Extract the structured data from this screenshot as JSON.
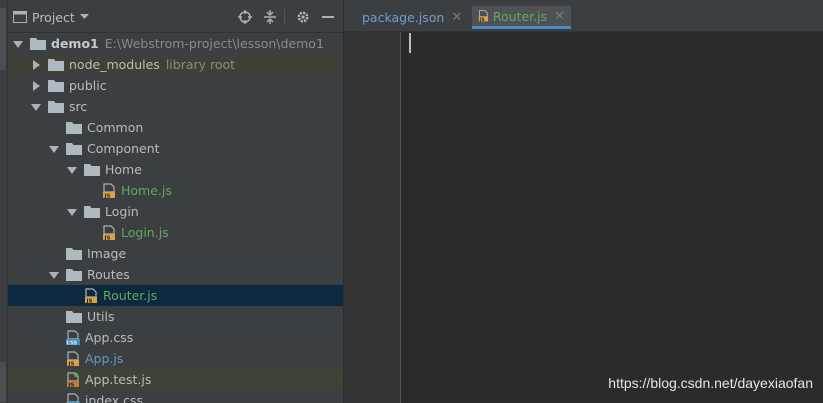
{
  "project_panel": {
    "title": "Project",
    "header_icons": [
      "locate-icon",
      "collapse-icon",
      "gear-icon",
      "minimize-icon"
    ]
  },
  "tree": [
    {
      "indent": 0,
      "expanded": true,
      "type": "folder",
      "label": "demo1",
      "hint": "E:\\Webstrom-project\\lesson\\demo1",
      "bold": true
    },
    {
      "indent": 1,
      "expanded": false,
      "type": "folder",
      "label": "node_modules",
      "hint": "library root",
      "bg": "brown"
    },
    {
      "indent": 1,
      "expanded": false,
      "type": "folder",
      "label": "public"
    },
    {
      "indent": 1,
      "expanded": true,
      "type": "folder",
      "label": "src"
    },
    {
      "indent": 2,
      "type": "folder",
      "label": "Common"
    },
    {
      "indent": 2,
      "expanded": true,
      "type": "folder",
      "label": "Component"
    },
    {
      "indent": 3,
      "expanded": true,
      "type": "folder",
      "label": "Home"
    },
    {
      "indent": 4,
      "type": "js",
      "label": "Home.js",
      "color": "green"
    },
    {
      "indent": 3,
      "expanded": true,
      "type": "folder",
      "label": "Login"
    },
    {
      "indent": 4,
      "type": "js",
      "label": "Login.js",
      "color": "green"
    },
    {
      "indent": 2,
      "type": "folder",
      "label": "Image"
    },
    {
      "indent": 2,
      "expanded": true,
      "type": "folder",
      "label": "Routes"
    },
    {
      "indent": 3,
      "type": "js",
      "label": "Router.js",
      "color": "green",
      "selected": true
    },
    {
      "indent": 2,
      "type": "folder",
      "label": "Utils"
    },
    {
      "indent": 2,
      "type": "css",
      "label": "App.css"
    },
    {
      "indent": 2,
      "type": "js",
      "label": "App.js",
      "color": "blue"
    },
    {
      "indent": 2,
      "type": "testjs",
      "label": "App.test.js",
      "bg": "green"
    },
    {
      "indent": 2,
      "type": "css",
      "label": "index.css"
    }
  ],
  "tabs": [
    {
      "label": "package.json",
      "icon": "json-file-icon",
      "active": false
    },
    {
      "label": "Router.js",
      "icon": "js-file-icon",
      "active": true
    }
  ],
  "watermark": "https://blog.csdn.net/dayexiaofan",
  "colors": {
    "panel_bg": "#3c3f41",
    "editor_bg": "#2b2b2b",
    "selected_row": "#0d293e",
    "green_text": "#62a862",
    "blue_text": "#6897bb",
    "accent": "#4a88c7"
  }
}
